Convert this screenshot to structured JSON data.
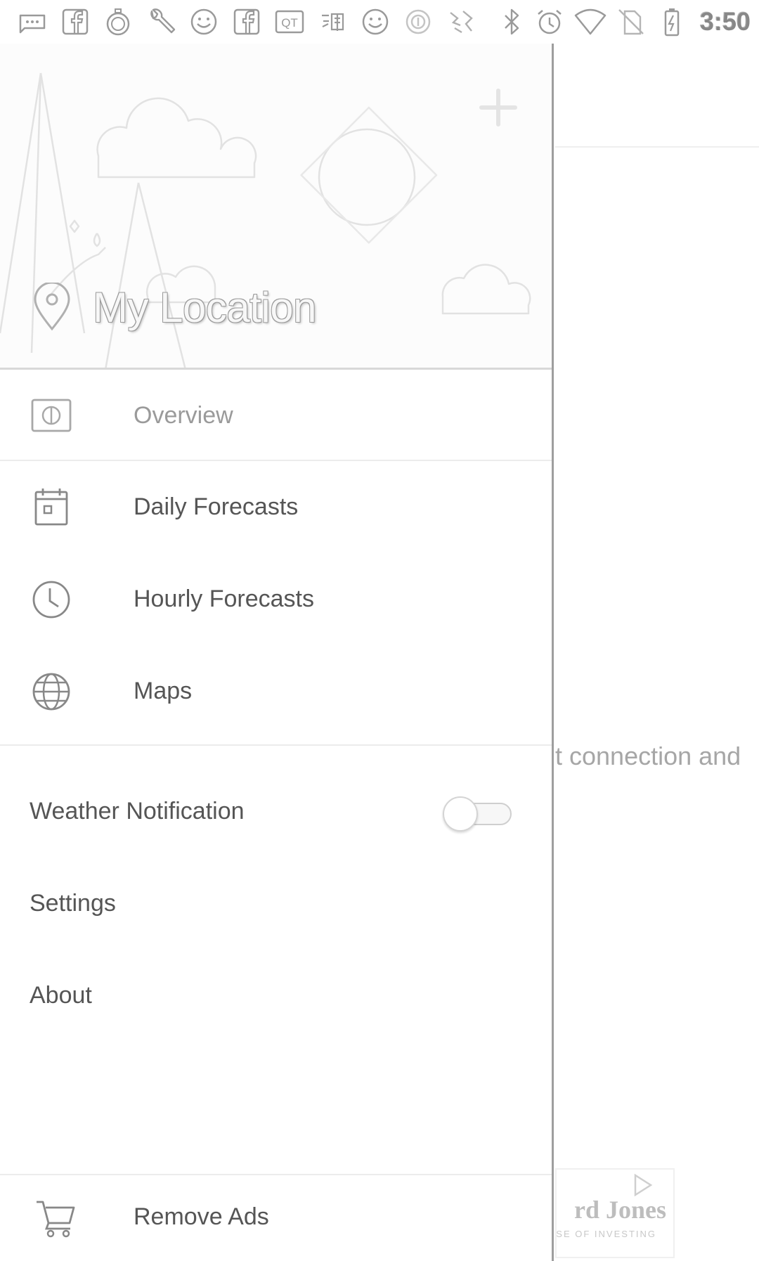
{
  "status_bar": {
    "time": "3:50",
    "notification_icons": [
      "chat-bubble-icon",
      "facebook-icon",
      "stopwatch-icon",
      "wrench-icon",
      "smiley-icon",
      "facebook-icon",
      "qt-icon",
      "taobao-icon",
      "smiley-icon",
      "circle-app-icon",
      "app-icon"
    ],
    "system_icons": [
      "bluetooth-icon",
      "alarm-icon",
      "wifi-icon",
      "no-sim-icon",
      "battery-charging-icon"
    ]
  },
  "drawer": {
    "location_name": "My Location",
    "nav_items": [
      {
        "label": "Overview",
        "icon": "overview-icon",
        "selected": true
      },
      {
        "label": "Daily Forecasts",
        "icon": "calendar-icon",
        "selected": false
      },
      {
        "label": "Hourly Forecasts",
        "icon": "clock-icon",
        "selected": false
      },
      {
        "label": "Maps",
        "icon": "globe-icon",
        "selected": false
      }
    ],
    "menu_items": [
      {
        "label": "Weather Notification",
        "toggle": false
      },
      {
        "label": "Settings"
      },
      {
        "label": "About"
      }
    ],
    "footer": {
      "label": "Remove Ads",
      "icon": "cart-icon"
    }
  },
  "background": {
    "error_text_visible": "t connection and",
    "ad_brand_partial": "rd Jones",
    "ad_tagline_partial": "NSE OF INVESTING"
  }
}
